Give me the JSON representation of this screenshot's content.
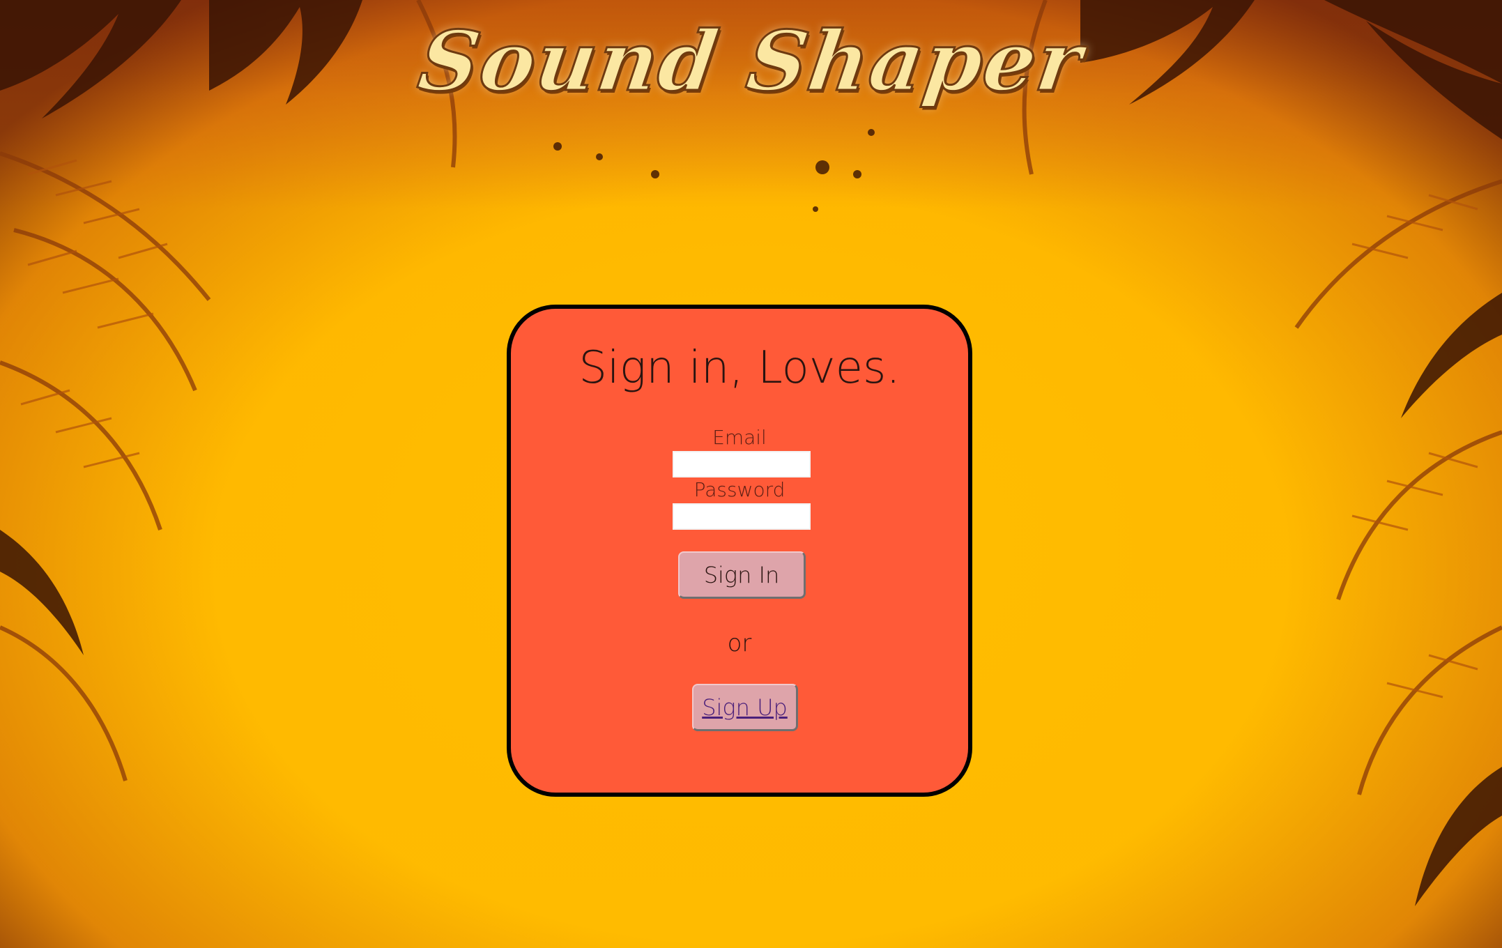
{
  "app": {
    "logo_text": "Sound Shaper"
  },
  "signin_card": {
    "title": "Sign in, Loves.",
    "email_label": "Email",
    "email_value": "",
    "password_label": "Password",
    "password_value": "",
    "signin_button": "Sign In",
    "or_text": "or",
    "signup_link": "Sign Up"
  },
  "theme": {
    "background": "#ffbb00",
    "card_color": "#ff5a38",
    "card_border": "#000000",
    "button_color": "#dea4aa",
    "logo_color": "#fbe7a2",
    "link_color": "#4a1f7a"
  }
}
